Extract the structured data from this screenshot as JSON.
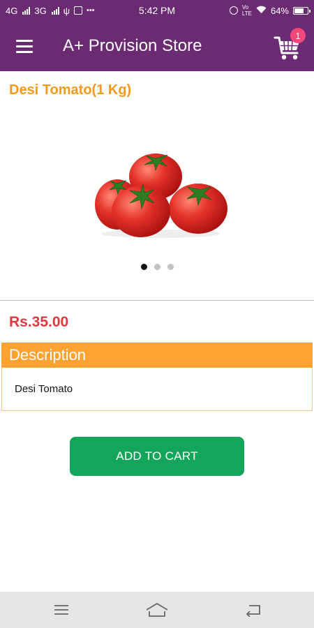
{
  "status_bar": {
    "net1": "4G",
    "net2": "3G",
    "time": "5:42 PM",
    "volte": "Vo\nLTE",
    "battery": "64%",
    "dots": "•••"
  },
  "app_bar": {
    "title": "A+ Provision Store",
    "cart_count": "1",
    "menu_icon": "hamburger-menu-icon",
    "cart_icon": "shopping-cart-icon"
  },
  "product": {
    "title": "Desi Tomato(1 Kg)",
    "image": "tomato-image",
    "carousel": {
      "count": 3,
      "active_index": 0
    },
    "price": "Rs.35.00"
  },
  "description": {
    "header": "Description",
    "text": "Desi Tomato"
  },
  "actions": {
    "add_to_cart": "ADD TO CART"
  },
  "nav_bar": {
    "icons": [
      "menu-lines-icon",
      "home-icon",
      "back-icon"
    ]
  },
  "colors": {
    "app_bar": "#6a2b73",
    "title_orange": "#f39a1e",
    "price_red": "#e0393e",
    "description_header": "#ffa22f",
    "add_button": "#13a55a",
    "badge": "#f0487a"
  }
}
